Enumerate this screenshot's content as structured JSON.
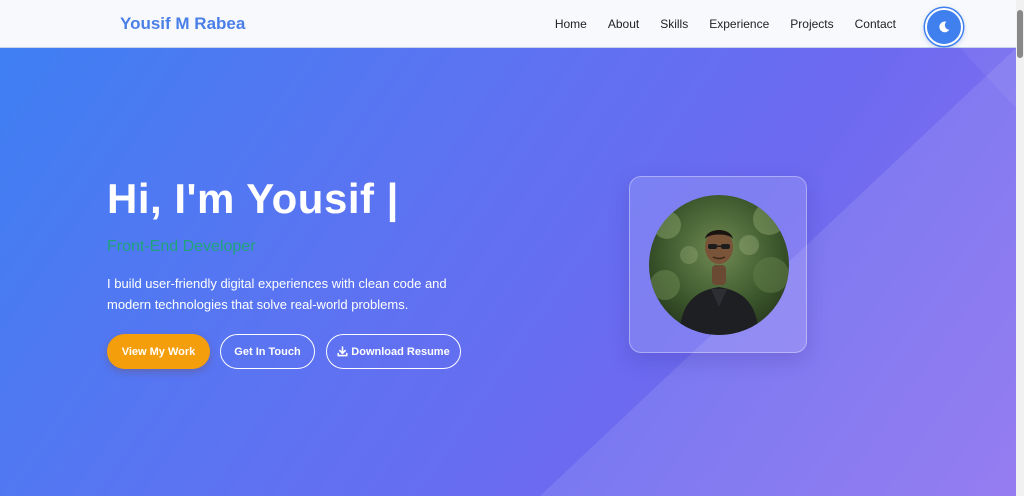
{
  "navbar": {
    "logo": "Yousif M Rabea",
    "links": [
      "Home",
      "About",
      "Skills",
      "Experience",
      "Projects",
      "Contact"
    ],
    "theme_toggle_icon": "moon-icon"
  },
  "hero": {
    "title": "Hi, I'm Yousif |",
    "subtitle": "Front-End Developer",
    "description": "I build user-friendly digital experiences with clean code and modern technologies that solve real-world problems.",
    "buttons": {
      "primary": "View My Work",
      "contact": "Get In Touch",
      "resume": "Download Resume"
    },
    "resume_icon": "download-icon",
    "photo_alt": "profile-photo"
  },
  "colors": {
    "accent": "#3f80ee",
    "primary_button": "#f59e0b",
    "subtitle": "#1fa37a",
    "hero_start": "#3f7ff3",
    "hero_end": "#8a6ff0"
  }
}
